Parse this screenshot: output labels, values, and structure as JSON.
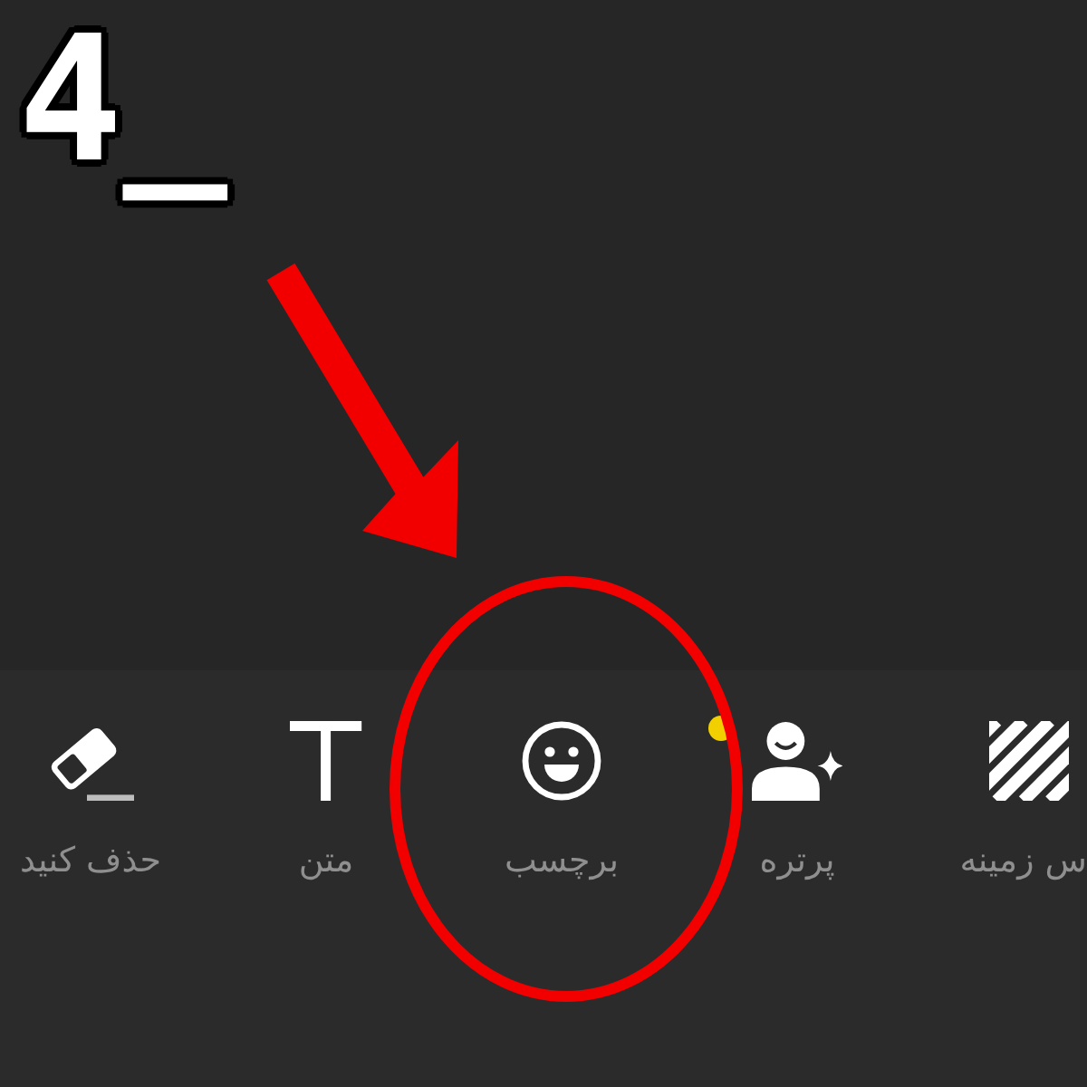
{
  "step_label": "4_",
  "toolbar": {
    "items": [
      {
        "kind": "background",
        "label": "س زمینه",
        "new_dot": false,
        "highlighted": false
      },
      {
        "kind": "portrait",
        "label": "پرتره",
        "new_dot": true,
        "highlighted": false
      },
      {
        "kind": "sticker",
        "label": "برچسب",
        "new_dot": false,
        "highlighted": true
      },
      {
        "kind": "text",
        "label": "متن",
        "new_dot": false,
        "highlighted": false
      },
      {
        "kind": "eraser",
        "label": "حذف کنید",
        "new_dot": false,
        "highlighted": false
      }
    ]
  }
}
